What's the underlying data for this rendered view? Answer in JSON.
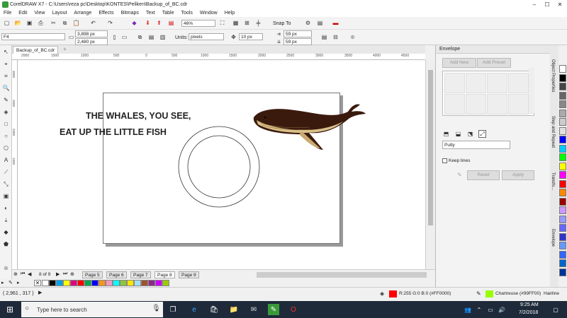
{
  "window": {
    "title": "CorelDRAW X7 - C:\\Users\\reza pc\\Desktop\\KONTES\\Peliken\\Backup_of_BC.cdr",
    "minimize": "–",
    "maximize": "☐",
    "close": "✕"
  },
  "menu": [
    "File",
    "Edit",
    "View",
    "Layout",
    "Arrange",
    "Effects",
    "Bitmaps",
    "Text",
    "Table",
    "Tools",
    "Window",
    "Help"
  ],
  "toolbar": {
    "zoom": "46%",
    "snap": "Snap To"
  },
  "propbar": {
    "page_size": "F4",
    "width": "3,898 px",
    "height": "2,480 px",
    "units_label": "Units:",
    "units": "pixels",
    "nudge": "10 px",
    "dup_x": "59 px",
    "dup_y": "59 px"
  },
  "document": {
    "tab": "Backup_of_BC.cdr",
    "text_line1": "THE WHALES, YOU SEE,",
    "text_line2": "EAT UP THE LITTLE FISH"
  },
  "ruler": {
    "h_ticks": [
      "2000",
      "1500",
      "1000",
      "500",
      "0",
      "500",
      "1000",
      "1500",
      "2000",
      "2500",
      "3000",
      "3500",
      "4000",
      "4500"
    ],
    "v_ticks": [
      "3000",
      "2500",
      "2000",
      "1500"
    ]
  },
  "pages": {
    "counter": "8 of 9",
    "tabs": [
      "Page 5",
      "Page 6",
      "Page 7",
      "Page 8",
      "Page 9"
    ],
    "active": "Page 8"
  },
  "docker": {
    "title": "Envelope",
    "add_new": "Add New",
    "add_preset": "Add Preset",
    "mode": "Putty",
    "keep_lines": "Keep lines",
    "reset": "Reset",
    "apply": "Apply",
    "side_tabs": [
      "Object Properties",
      "Step and Repeat",
      "Transfo...",
      "Envelope"
    ]
  },
  "status": {
    "coords": "( 2,961 , 317 )",
    "fill": "R:255 G:0 B:0 (#FF0000)",
    "outline": "Chartreuse (#99FF00)",
    "outline_width": "Hairline"
  },
  "taskbar": {
    "search_placeholder": "Type here to search",
    "time": "9:25 AM",
    "date": "7/2/2018"
  },
  "palette_colors": [
    "#ffffff",
    "#000000",
    "#00a0e9",
    "#ffff00",
    "#e4007f",
    "#ff0000",
    "#00a651",
    "#0000ff",
    "#f7941d",
    "#f49ac1",
    "#00ffff",
    "#8dc63f",
    "#ffe600",
    "#a3e0f7",
    "#a0522d",
    "#8b2a8b",
    "#cc00ff",
    "#99cc00"
  ],
  "right_palette": [
    "#ffffff",
    "#000000",
    "#444444",
    "#666666",
    "#888888",
    "#aaaaaa",
    "#cccccc",
    "#e0e0e0",
    "#0000ff",
    "#00ccff",
    "#00ff00",
    "#ffff00",
    "#ff00ff",
    "#ff0000",
    "#ff8800",
    "#990000",
    "#cc99ff",
    "#9999ff",
    "#6666ff",
    "#3333cc",
    "#6699ff",
    "#3366ff",
    "#0066cc",
    "#003399"
  ],
  "colors": {
    "fill": "#ff0000",
    "outline": "#99ff00"
  }
}
